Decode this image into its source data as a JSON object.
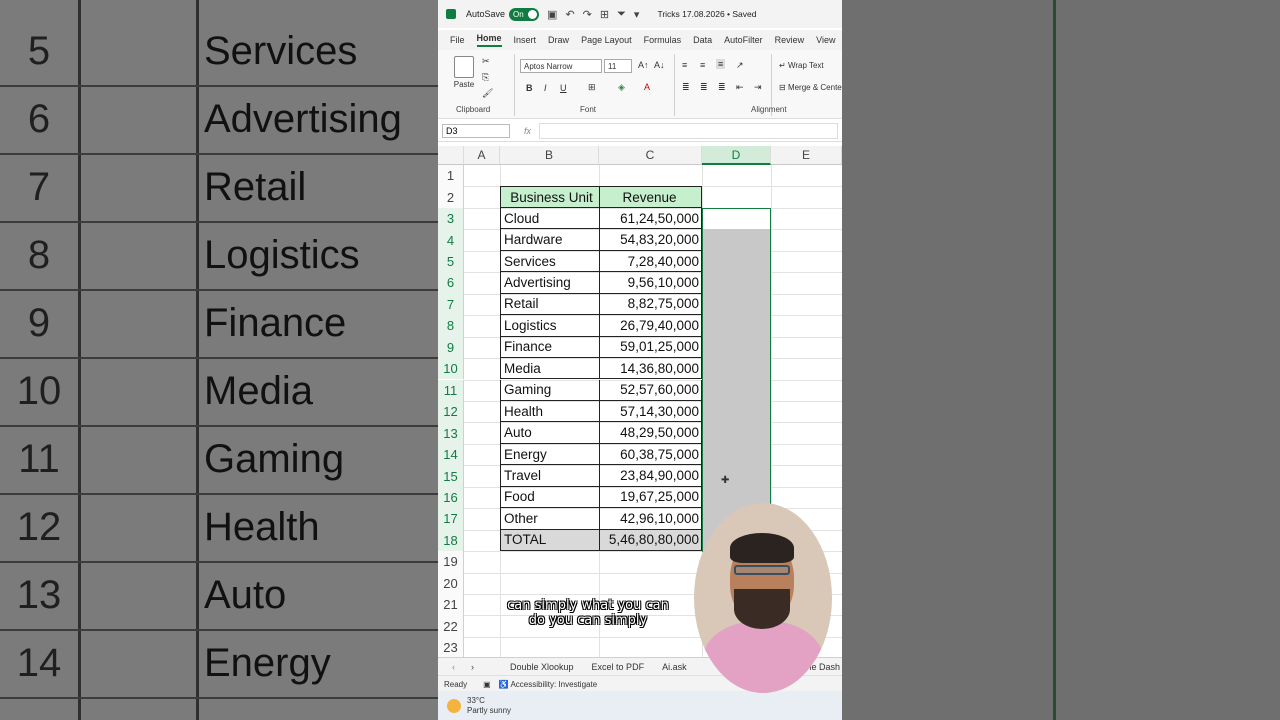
{
  "background": {
    "left_rows": [
      {
        "num": "5",
        "name": "Services"
      },
      {
        "num": "6",
        "name": "Advertising"
      },
      {
        "num": "7",
        "name": "Retail"
      },
      {
        "num": "8",
        "name": "Logistics"
      },
      {
        "num": "9",
        "name": "Finance"
      },
      {
        "num": "10",
        "name": "Media"
      },
      {
        "num": "11",
        "name": "Gaming"
      },
      {
        "num": "12",
        "name": "Health"
      },
      {
        "num": "13",
        "name": "Auto"
      },
      {
        "num": "14",
        "name": "Energy"
      }
    ]
  },
  "titlebar": {
    "autosave_label": "AutoSave",
    "autosave_state": "On",
    "doc_title": "Tricks 17.08.2026 • Saved"
  },
  "tabs": [
    "File",
    "Home",
    "Insert",
    "Draw",
    "Page Layout",
    "Formulas",
    "Data",
    "AutoFilter",
    "Review",
    "View"
  ],
  "ribbon": {
    "paste_label": "Paste",
    "clipboard_label": "Clipboard",
    "font_label": "Font",
    "alignment_label": "Alignment",
    "font_name": "Aptos Narrow",
    "font_size": "11",
    "wrap_text": "Wrap Text",
    "merge_center": "Merge & Center"
  },
  "formula_bar": {
    "name_box": "D3",
    "fx": "fx",
    "value": ""
  },
  "columns": [
    "A",
    "B",
    "C",
    "D",
    "E"
  ],
  "rows": [
    "1",
    "2",
    "3",
    "4",
    "5",
    "6",
    "7",
    "8",
    "9",
    "10",
    "11",
    "12",
    "13",
    "14",
    "15",
    "16",
    "17",
    "18",
    "19",
    "20",
    "21",
    "22",
    "23"
  ],
  "table": {
    "headers": {
      "unit": "Business Unit",
      "revenue": "Revenue"
    },
    "data": [
      {
        "unit": "Cloud",
        "revenue": "61,24,50,000"
      },
      {
        "unit": "Hardware",
        "revenue": "54,83,20,000"
      },
      {
        "unit": "Services",
        "revenue": "7,28,40,000"
      },
      {
        "unit": "Advertising",
        "revenue": "9,56,10,000"
      },
      {
        "unit": "Retail",
        "revenue": "8,82,75,000"
      },
      {
        "unit": "Logistics",
        "revenue": "26,79,40,000"
      },
      {
        "unit": "Finance",
        "revenue": "59,01,25,000"
      },
      {
        "unit": "Media",
        "revenue": "14,36,80,000"
      },
      {
        "unit": "Gaming",
        "revenue": "52,57,60,000"
      },
      {
        "unit": "Health",
        "revenue": "57,14,30,000"
      },
      {
        "unit": "Auto",
        "revenue": "48,29,50,000"
      },
      {
        "unit": "Energy",
        "revenue": "60,38,75,000"
      },
      {
        "unit": "Travel",
        "revenue": "23,84,90,000"
      },
      {
        "unit": "Food",
        "revenue": "19,67,25,000"
      },
      {
        "unit": "Other",
        "revenue": "42,96,10,000"
      }
    ],
    "total": {
      "unit": "TOTAL",
      "revenue": "5,46,80,80,000"
    }
  },
  "sheet_tabs": [
    "Double Xlookup",
    "Excel to PDF",
    "Ai.ask",
    "le Dash"
  ],
  "status": {
    "ready": "Ready",
    "accessibility": "Accessibility: Investigate"
  },
  "taskbar": {
    "temp": "33°C",
    "weather": "Partly sunny"
  },
  "subtitle": {
    "line1": "can simply what you can",
    "line2": "do you can simply"
  },
  "colors": {
    "excel_green": "#107c41",
    "header_fill": "#c6efce",
    "total_fill": "#d9d9d9"
  }
}
